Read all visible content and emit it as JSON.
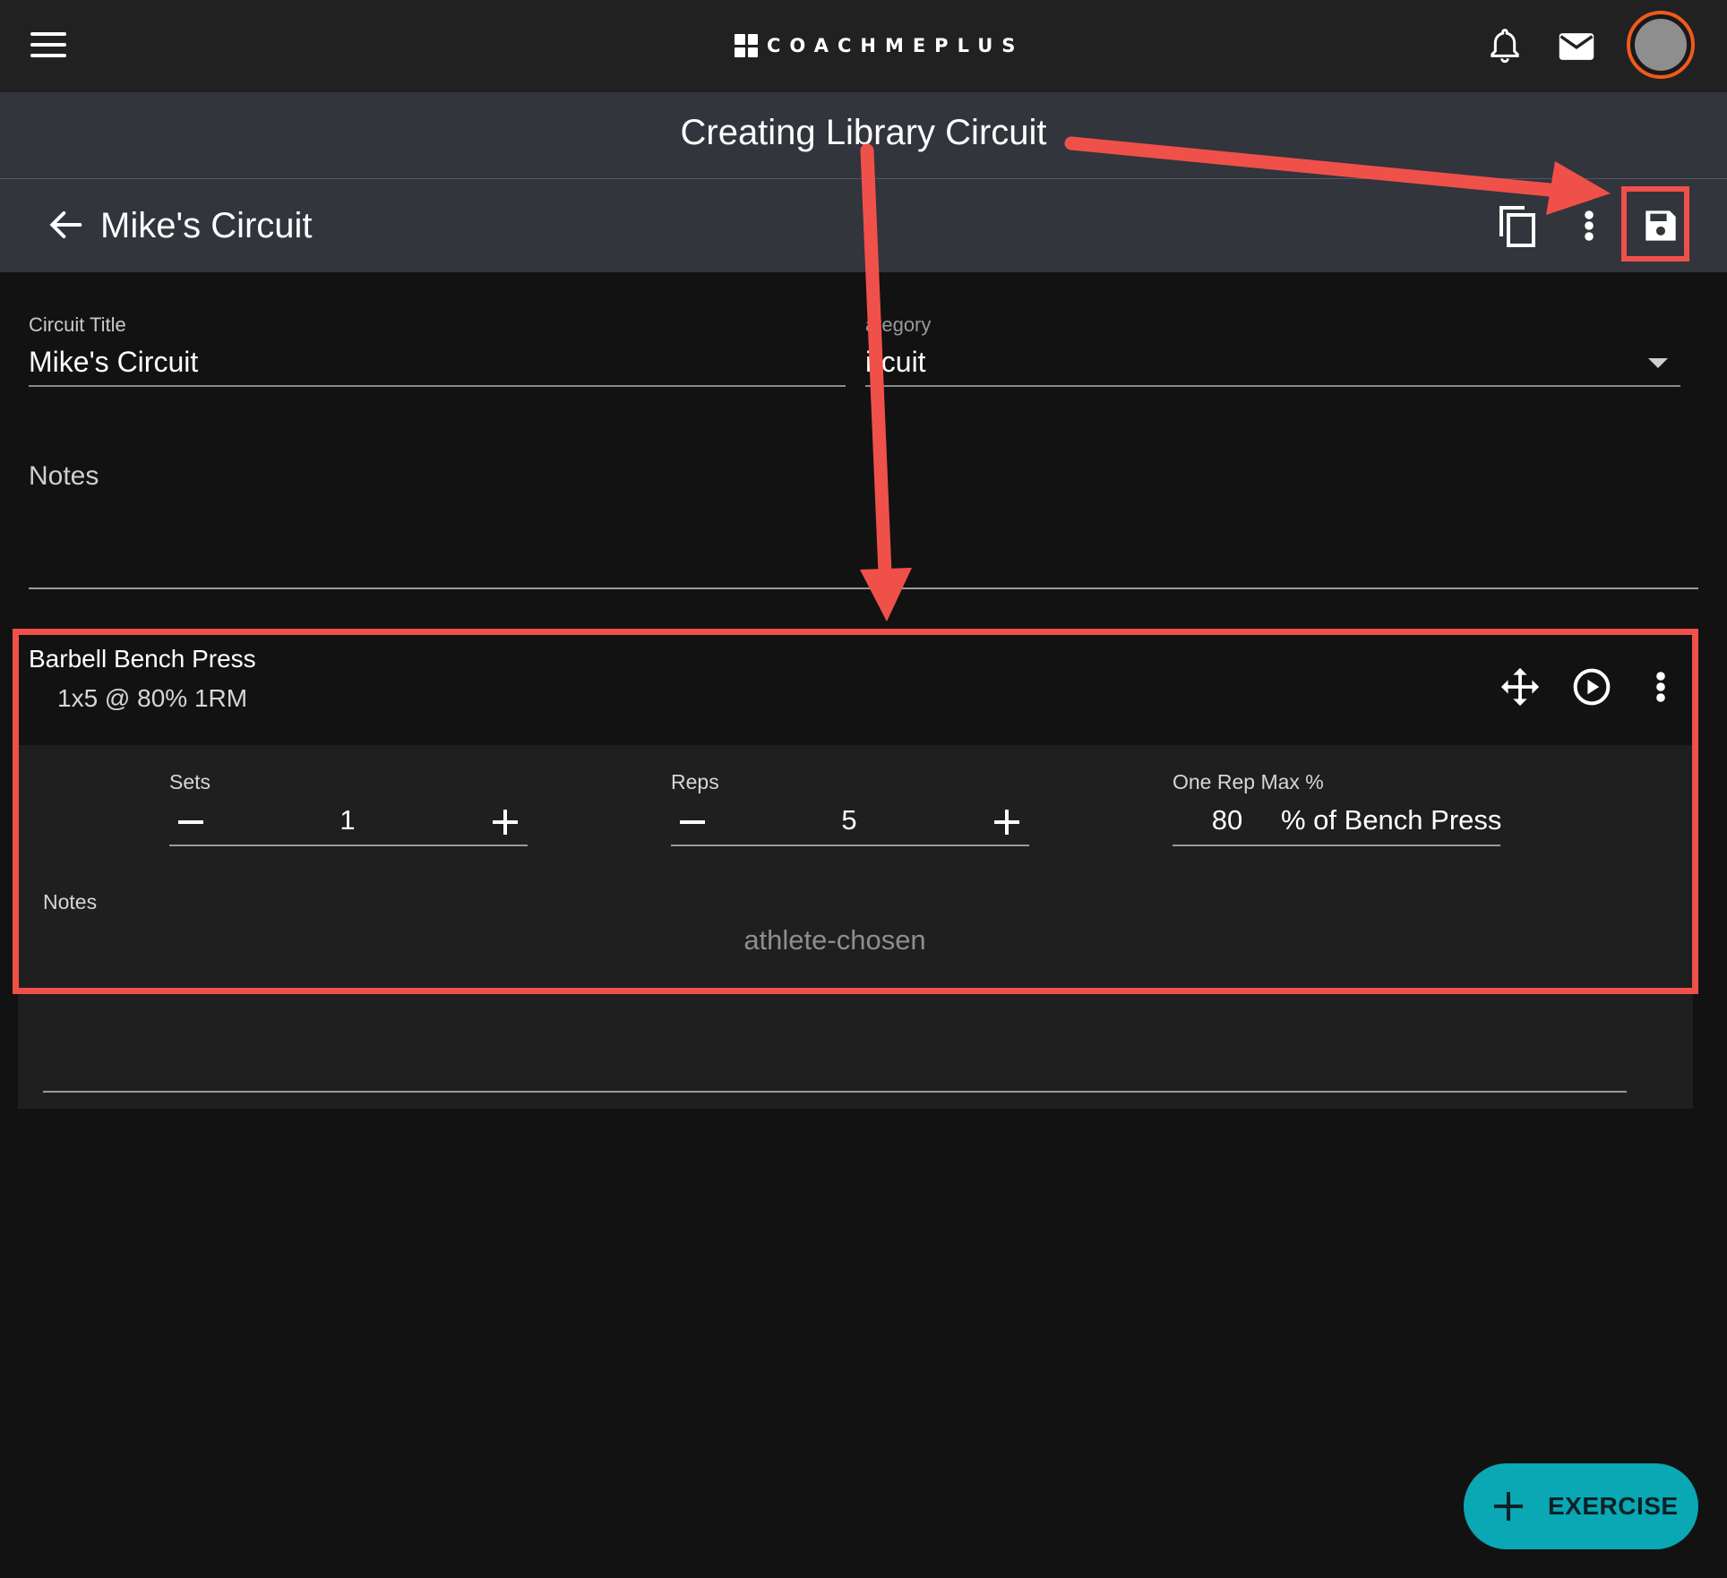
{
  "app": {
    "logo_text": "COACHMEPLUS",
    "page_title": "Creating Library Circuit"
  },
  "header": {
    "menu_icon": "hamburger-menu-icon",
    "notifications_icon": "bell-icon",
    "messages_icon": "mail-icon",
    "avatar": "user-avatar"
  },
  "toolbar": {
    "circuit_name": "Mike's Circuit",
    "back_icon": "arrow-left-icon",
    "copy_icon": "copy-icon",
    "more_icon": "more-vertical-icon",
    "save_icon": "save-icon"
  },
  "form": {
    "title_label": "Circuit Title",
    "title_value": "Mike's Circuit",
    "category_label": "ategory",
    "category_value": "ircuit",
    "notes_label": "Notes"
  },
  "exercise": {
    "name": "Barbell Bench Press",
    "summary": "1x5  @ 80% 1RM",
    "sets_label": "Sets",
    "sets_value": "1",
    "reps_label": "Reps",
    "reps_value": "5",
    "orm_label": "One Rep Max %",
    "orm_value": "80",
    "orm_suffix": "% of Bench Press",
    "notes_label": "Notes",
    "notes_value": "athlete-chosen"
  },
  "fab": {
    "label": "EXERCISE"
  },
  "colors": {
    "accent": "#0aa7b4",
    "annotation": "#f0504a",
    "avatar_ring": "#f05a1a"
  }
}
